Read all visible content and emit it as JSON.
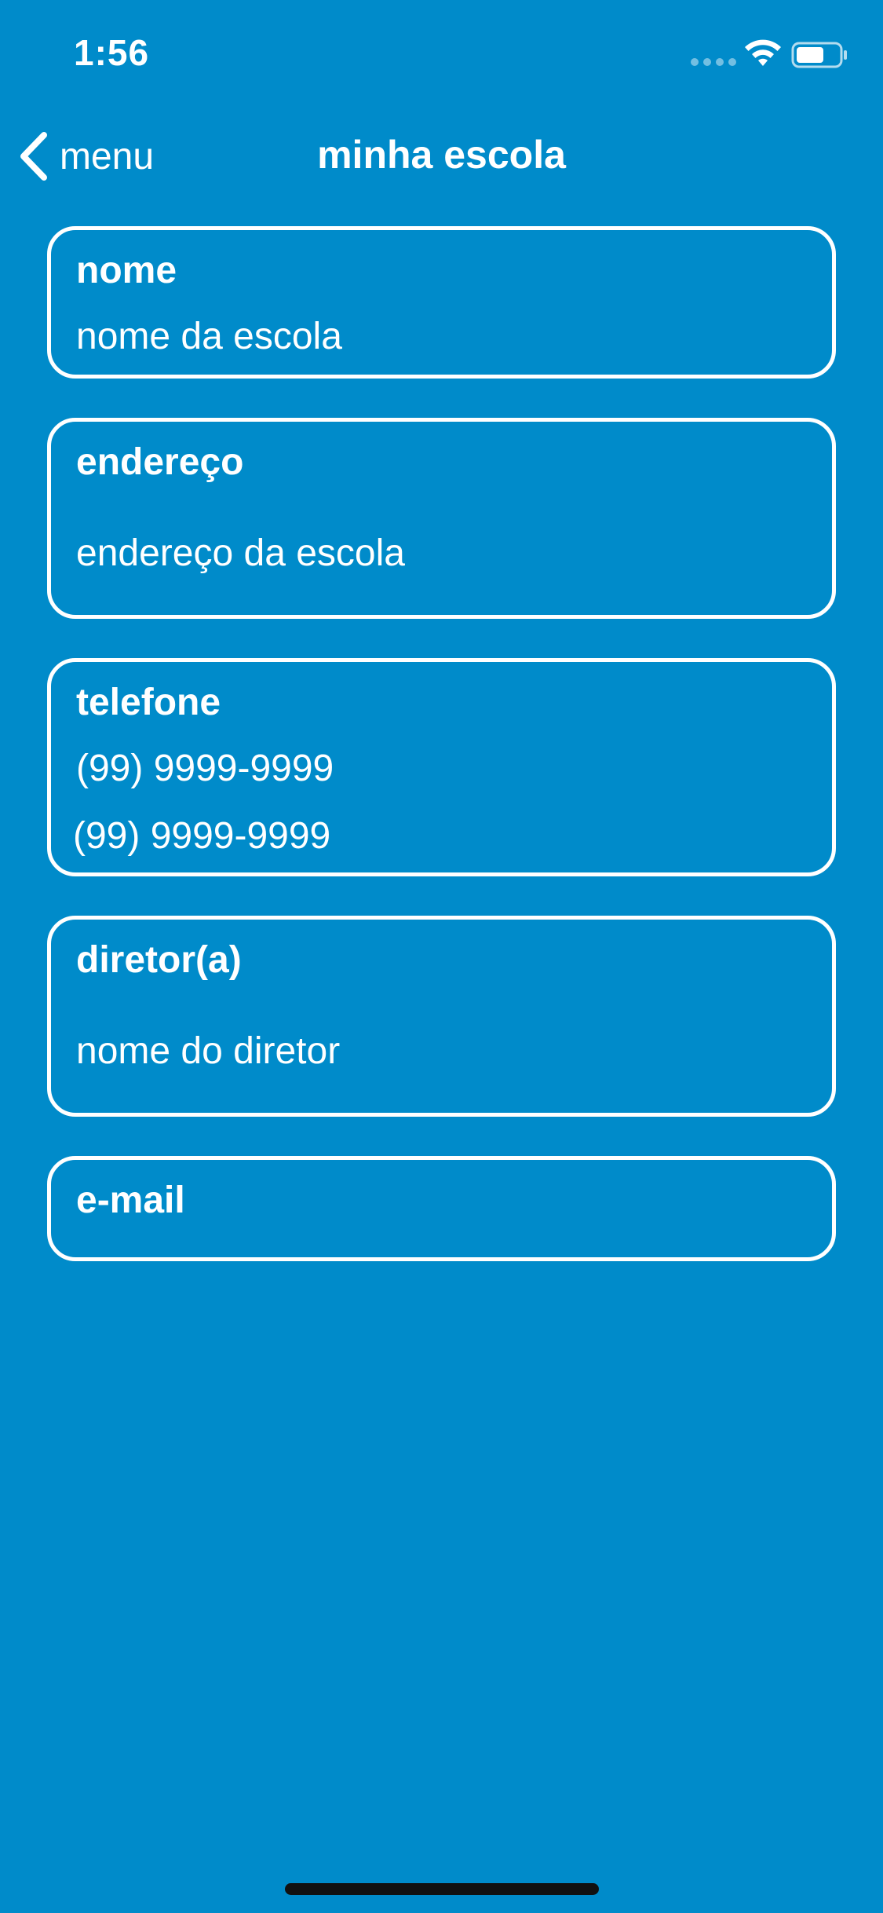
{
  "status_bar": {
    "time": "1:56"
  },
  "nav": {
    "back_label": "menu",
    "title": "minha escola"
  },
  "fields": {
    "nome": {
      "label": "nome",
      "value": "nome da escola"
    },
    "endereco": {
      "label": "endereço",
      "value": "endereço da escola"
    },
    "telefone": {
      "label": "telefone",
      "values": [
        "(99) 9999-9999",
        "(99) 9999-9999"
      ]
    },
    "diretor": {
      "label": "diretor(a)",
      "value": "nome do diretor"
    },
    "email": {
      "label": "e-mail",
      "value": ""
    }
  },
  "colors": {
    "background": "#008bca",
    "foreground": "#ffffff"
  }
}
